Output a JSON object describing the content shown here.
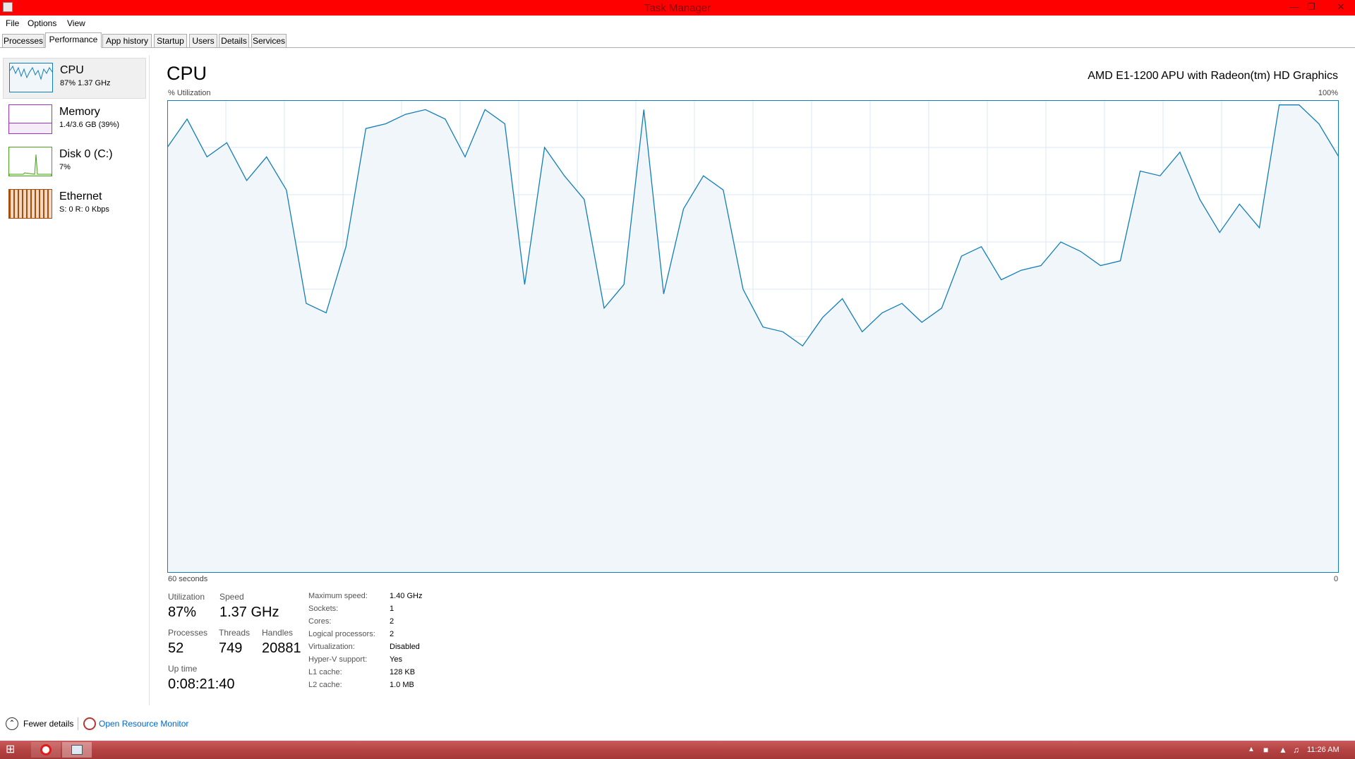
{
  "window": {
    "title": "Task Manager"
  },
  "menu": [
    "File",
    "Options",
    "View"
  ],
  "tabs": [
    "Processes",
    "Performance",
    "App history",
    "Startup",
    "Users",
    "Details",
    "Services"
  ],
  "sidebar": [
    {
      "name": "CPU",
      "sub": "87%  1.37 GHz",
      "color": "#1b8fd6"
    },
    {
      "name": "Memory",
      "sub": "1.4/3.6 GB (39%)",
      "color": "#9b36c3"
    },
    {
      "name": "Disk 0 (C:)",
      "sub": "7%",
      "color": "#4aa11c"
    },
    {
      "name": "Ethernet",
      "sub": "S: 0  R: 0 Kbps",
      "color": "#a64f0c"
    }
  ],
  "main": {
    "title": "CPU",
    "processor": "AMD E1-1200 APU with Radeon(tm) HD Graphics",
    "y_label": "% Utilization",
    "y_max": "100%",
    "x_left": "60 seconds",
    "x_right": "0"
  },
  "chart_data": {
    "type": "area",
    "series": [
      {
        "values": [
          90,
          96,
          88,
          91,
          83,
          88,
          81,
          57,
          55,
          69,
          94,
          95,
          97,
          98,
          96,
          88,
          98,
          95,
          61,
          90,
          84,
          79,
          56,
          61,
          98,
          59,
          77,
          84,
          81,
          60,
          52,
          51,
          48,
          54,
          58,
          51,
          55,
          57,
          53,
          56,
          67,
          69,
          62,
          64,
          65,
          70,
          68,
          65,
          66,
          85,
          84,
          89,
          79,
          72,
          78,
          73,
          99,
          99,
          95,
          88
        ]
      }
    ],
    "ylim": [
      0,
      100
    ],
    "grid": true
  },
  "stats": {
    "utilization_label": "Utilization",
    "utilization": "87%",
    "speed_label": "Speed",
    "speed": "1.37 GHz",
    "processes_label": "Processes",
    "processes": "52",
    "threads_label": "Threads",
    "threads": "749",
    "handles_label": "Handles",
    "handles": "20881",
    "uptime_label": "Up time",
    "uptime": "0:08:21:40"
  },
  "specs": [
    {
      "label": "Maximum speed:",
      "value": "1.40 GHz"
    },
    {
      "label": "Sockets:",
      "value": "1"
    },
    {
      "label": "Cores:",
      "value": "2"
    },
    {
      "label": "Logical processors:",
      "value": "2"
    },
    {
      "label": "Virtualization:",
      "value": "Disabled"
    },
    {
      "label": "Hyper-V support:",
      "value": "Yes"
    },
    {
      "label": "L1 cache:",
      "value": "128 KB"
    },
    {
      "label": "L2 cache:",
      "value": "1.0 MB"
    }
  ],
  "footer": {
    "fewer": "Fewer details",
    "resource": "Open Resource Monitor"
  },
  "taskbar": {
    "time": "11:26 AM"
  },
  "colors": {
    "titlebar": "#ff0000",
    "cpu_line": "#117dbb",
    "cpu_fill": "#f1f6fa",
    "grid": "#d9eaf4",
    "link": "#0066cc"
  }
}
